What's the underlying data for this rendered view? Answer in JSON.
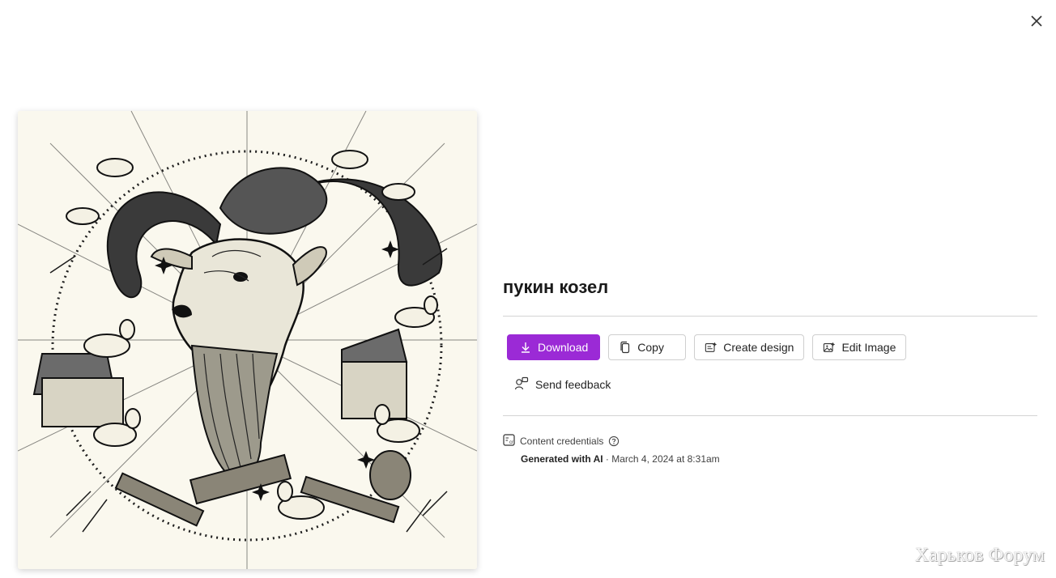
{
  "dialog": {
    "close_icon": "close-icon"
  },
  "image": {
    "subject": "goat-illustration"
  },
  "details": {
    "title": "пукин козел",
    "actions": [
      {
        "label": "Download",
        "icon": "download-icon"
      },
      {
        "label": "Copy",
        "icon": "copy-icon"
      },
      {
        "label": "Create design",
        "icon": "create-design-icon"
      },
      {
        "label": "Edit Image",
        "icon": "edit-image-icon"
      }
    ],
    "feedback_label": "Send feedback",
    "credentials": {
      "label": "Content credentials",
      "generated_label": "Generated with AI",
      "separator": " · ",
      "date": "March 4, 2024 at 8:31am"
    }
  },
  "watermark": "Харьков Форум",
  "colors": {
    "primary": "#9b2ad6",
    "divider": "#d4d4d4"
  }
}
